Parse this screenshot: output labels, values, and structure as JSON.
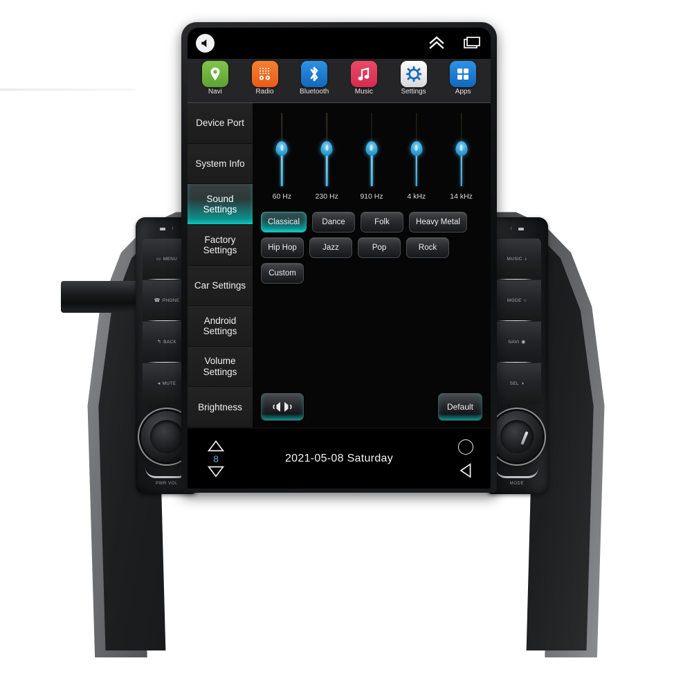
{
  "device": {
    "name": "car-stereo-head-unit",
    "accent_teal": "#16b5b0",
    "slider_blue": "#3ba8dd"
  },
  "status_bar": {
    "mute_icon": "speaker-mute-icon",
    "chevron_icon": "chevron-double-up-icon",
    "recents_icon": "recent-apps-icon"
  },
  "dock": {
    "items": [
      {
        "label": "Navi",
        "icon": "map-pin-icon",
        "color": "#6db33f"
      },
      {
        "label": "Radio",
        "icon": "radio-icon",
        "color": "#ef6724"
      },
      {
        "label": "Bluetooth",
        "icon": "bluetooth-icon",
        "color": "#1b79d0"
      },
      {
        "label": "Music",
        "icon": "music-note-icon",
        "color": "#e0395a"
      },
      {
        "label": "Settings",
        "icon": "gear-icon",
        "color": "#f2f2f2"
      },
      {
        "label": "Apps",
        "icon": "grid-apps-icon",
        "color": "#1f86e0"
      }
    ]
  },
  "sidebar": {
    "items": [
      {
        "label": "Device Port",
        "active": false
      },
      {
        "label": "System Info",
        "active": false
      },
      {
        "label": "Sound Settings",
        "active": true
      },
      {
        "label": "Factory Settings",
        "active": false
      },
      {
        "label": "Car Settings",
        "active": false
      },
      {
        "label": "Android Settings",
        "active": false
      },
      {
        "label": "Volume Settings",
        "active": false
      },
      {
        "label": "Brightness",
        "active": false
      }
    ]
  },
  "chart_data": {
    "type": "bar",
    "title": "Equalizer",
    "categories": [
      "60 Hz",
      "230 Hz",
      "910 Hz",
      "4 kHz",
      "14 kHz"
    ],
    "values": [
      50,
      50,
      50,
      50,
      50
    ],
    "xlabel": "",
    "ylabel": "",
    "ylim": [
      0,
      100
    ],
    "grid": false,
    "legend": "none"
  },
  "equalizer": {
    "bands": [
      {
        "label": "60 Hz",
        "percent": 50
      },
      {
        "label": "230 Hz",
        "percent": 50
      },
      {
        "label": "910 Hz",
        "percent": 50
      },
      {
        "label": "4 kHz",
        "percent": 50
      },
      {
        "label": "14 kHz",
        "percent": 50
      }
    ]
  },
  "presets": [
    {
      "label": "Classical",
      "active": true
    },
    {
      "label": "Dance",
      "active": false
    },
    {
      "label": "Folk",
      "active": false
    },
    {
      "label": "Heavy Metal",
      "active": false
    },
    {
      "label": "Hip Hop",
      "active": false
    },
    {
      "label": "Jazz",
      "active": false
    },
    {
      "label": "Pop",
      "active": false
    },
    {
      "label": "Rock",
      "active": false
    },
    {
      "label": "Custom",
      "active": false
    }
  ],
  "actions": {
    "balance_icon": "speaker-balance-icon",
    "default_label": "Default"
  },
  "nav_bar": {
    "volume_up_icon": "triangle-up-icon",
    "volume_value": "8",
    "volume_down_icon": "triangle-down-icon",
    "date": "2021-05-08  Saturday",
    "home_icon": "home-circle-icon",
    "back_icon": "back-triangle-icon"
  },
  "hardware": {
    "left_panel": {
      "buttons": [
        {
          "label": "MENU",
          "glyph": "▭"
        },
        {
          "label": "PHONE",
          "glyph": "☎"
        },
        {
          "label": "BACK",
          "glyph": "↰"
        },
        {
          "label": "MUTE",
          "glyph": "◂"
        }
      ],
      "knob_label": "PWR VOL"
    },
    "right_panel": {
      "buttons": [
        {
          "label": "MUSIC",
          "glyph": "♪"
        },
        {
          "label": "MODE",
          "glyph": "○"
        },
        {
          "label": "NAVI",
          "glyph": "◉"
        },
        {
          "label": "SEL",
          "glyph": "◑"
        }
      ],
      "knob_label": "MODE"
    }
  }
}
